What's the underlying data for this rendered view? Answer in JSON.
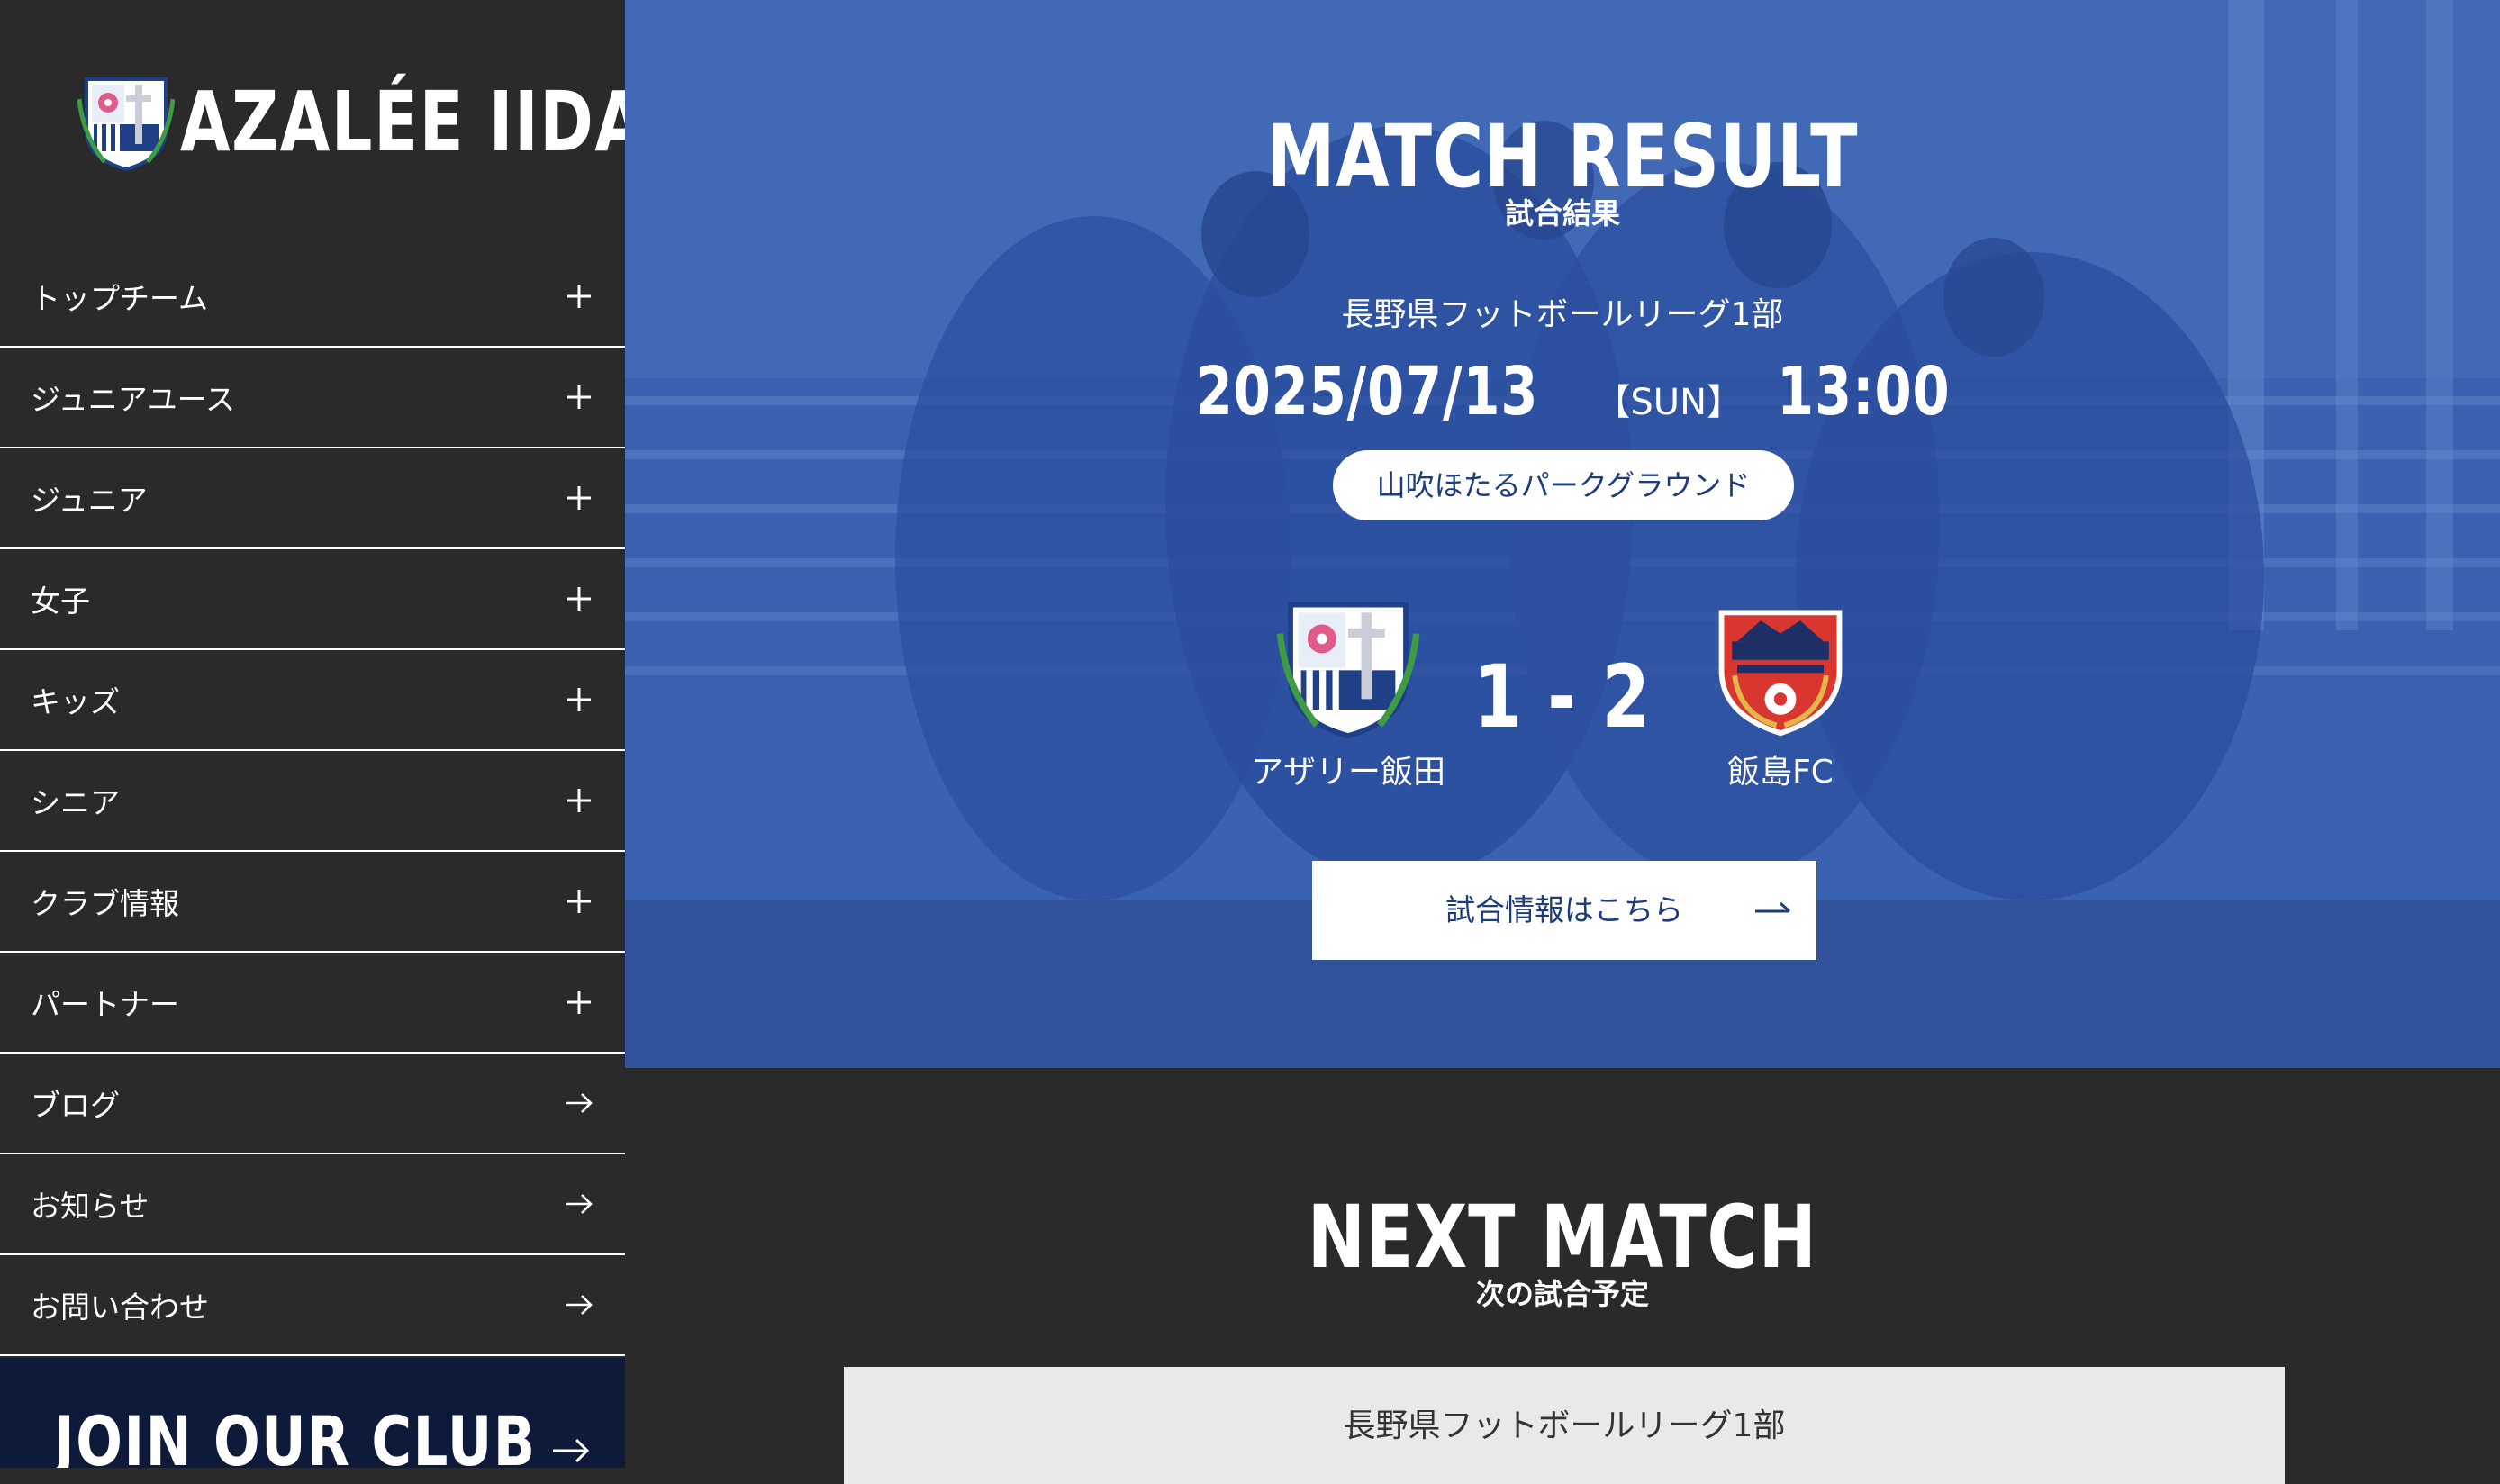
{
  "brand": {
    "name": "AZALÉE IIDA",
    "crest_icon": "azalee-crest-icon"
  },
  "sidebar": {
    "items": [
      {
        "label": "トップチーム",
        "icon": "plus-icon"
      },
      {
        "label": "ジュニアユース",
        "icon": "plus-icon"
      },
      {
        "label": "ジュニア",
        "icon": "plus-icon"
      },
      {
        "label": "女子",
        "icon": "plus-icon"
      },
      {
        "label": "キッズ",
        "icon": "plus-icon"
      },
      {
        "label": "シニア",
        "icon": "plus-icon"
      },
      {
        "label": "クラブ情報",
        "icon": "plus-icon"
      },
      {
        "label": "パートナー",
        "icon": "plus-icon"
      },
      {
        "label": "ブログ",
        "icon": "arrow-right-icon"
      },
      {
        "label": "お知らせ",
        "icon": "arrow-right-icon"
      },
      {
        "label": "お問い合わせ",
        "icon": "arrow-right-icon"
      }
    ],
    "join_label": "JOIN OUR CLUB"
  },
  "match_result": {
    "title": "MATCH RESULT",
    "subtitle": "試合結果",
    "league": "長野県フットボールリーグ1部",
    "date": "2025/07/13",
    "day": "【SUN】",
    "time": "13:00",
    "venue": "山吹ほたるパークグラウンド",
    "home_team": "アザリー飯田",
    "away_team": "飯島FC",
    "score": "1 - 2",
    "button_label": "試合情報はこちら"
  },
  "next_match": {
    "title": "NEXT MATCH",
    "subtitle": "次の試合予定",
    "league": "長野県フットボールリーグ1部"
  },
  "colors": {
    "sidebar_bg": "#2a2a2a",
    "hero_blue": "#3560ae",
    "accent_navy": "#1c3c7c",
    "join_bg": "#0d1a3a",
    "away_crest_red": "#d8362e"
  }
}
